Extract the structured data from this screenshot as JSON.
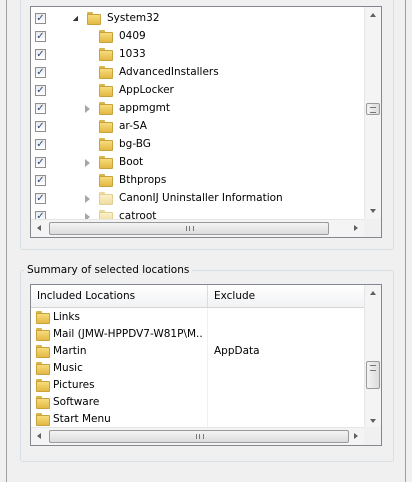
{
  "tree": {
    "items": [
      {
        "label": "System32",
        "checked": true,
        "expander": "open",
        "level": 0,
        "pale": false
      },
      {
        "label": "0409",
        "checked": true,
        "expander": "none",
        "level": 1,
        "pale": false
      },
      {
        "label": "1033",
        "checked": true,
        "expander": "none",
        "level": 1,
        "pale": false
      },
      {
        "label": "AdvancedInstallers",
        "checked": true,
        "expander": "none",
        "level": 1,
        "pale": false
      },
      {
        "label": "AppLocker",
        "checked": true,
        "expander": "none",
        "level": 1,
        "pale": false
      },
      {
        "label": "appmgmt",
        "checked": true,
        "expander": "closed",
        "level": 1,
        "pale": false
      },
      {
        "label": "ar-SA",
        "checked": true,
        "expander": "none",
        "level": 1,
        "pale": false
      },
      {
        "label": "bg-BG",
        "checked": true,
        "expander": "none",
        "level": 1,
        "pale": false
      },
      {
        "label": "Boot",
        "checked": true,
        "expander": "closed",
        "level": 1,
        "pale": false
      },
      {
        "label": "Bthprops",
        "checked": true,
        "expander": "none",
        "level": 1,
        "pale": false
      },
      {
        "label": "CanonIJ Uninstaller Information",
        "checked": true,
        "expander": "closed",
        "level": 1,
        "pale": true
      },
      {
        "label": "catroot",
        "checked": true,
        "expander": "closed",
        "level": 1,
        "pale": true
      }
    ],
    "check_mark": "✓"
  },
  "summary": {
    "group_label": "Summary of selected locations",
    "columns": [
      "Included Locations",
      "Exclude"
    ],
    "rows": [
      {
        "location": "Links",
        "exclude": ""
      },
      {
        "location": "Mail (JMW-HPPDV7-W81P\\M...",
        "exclude": ""
      },
      {
        "location": "Martin",
        "exclude": "AppData"
      },
      {
        "location": "Music",
        "exclude": ""
      },
      {
        "location": "Pictures",
        "exclude": ""
      },
      {
        "location": "Software",
        "exclude": ""
      },
      {
        "location": "Start Menu",
        "exclude": ""
      }
    ]
  }
}
